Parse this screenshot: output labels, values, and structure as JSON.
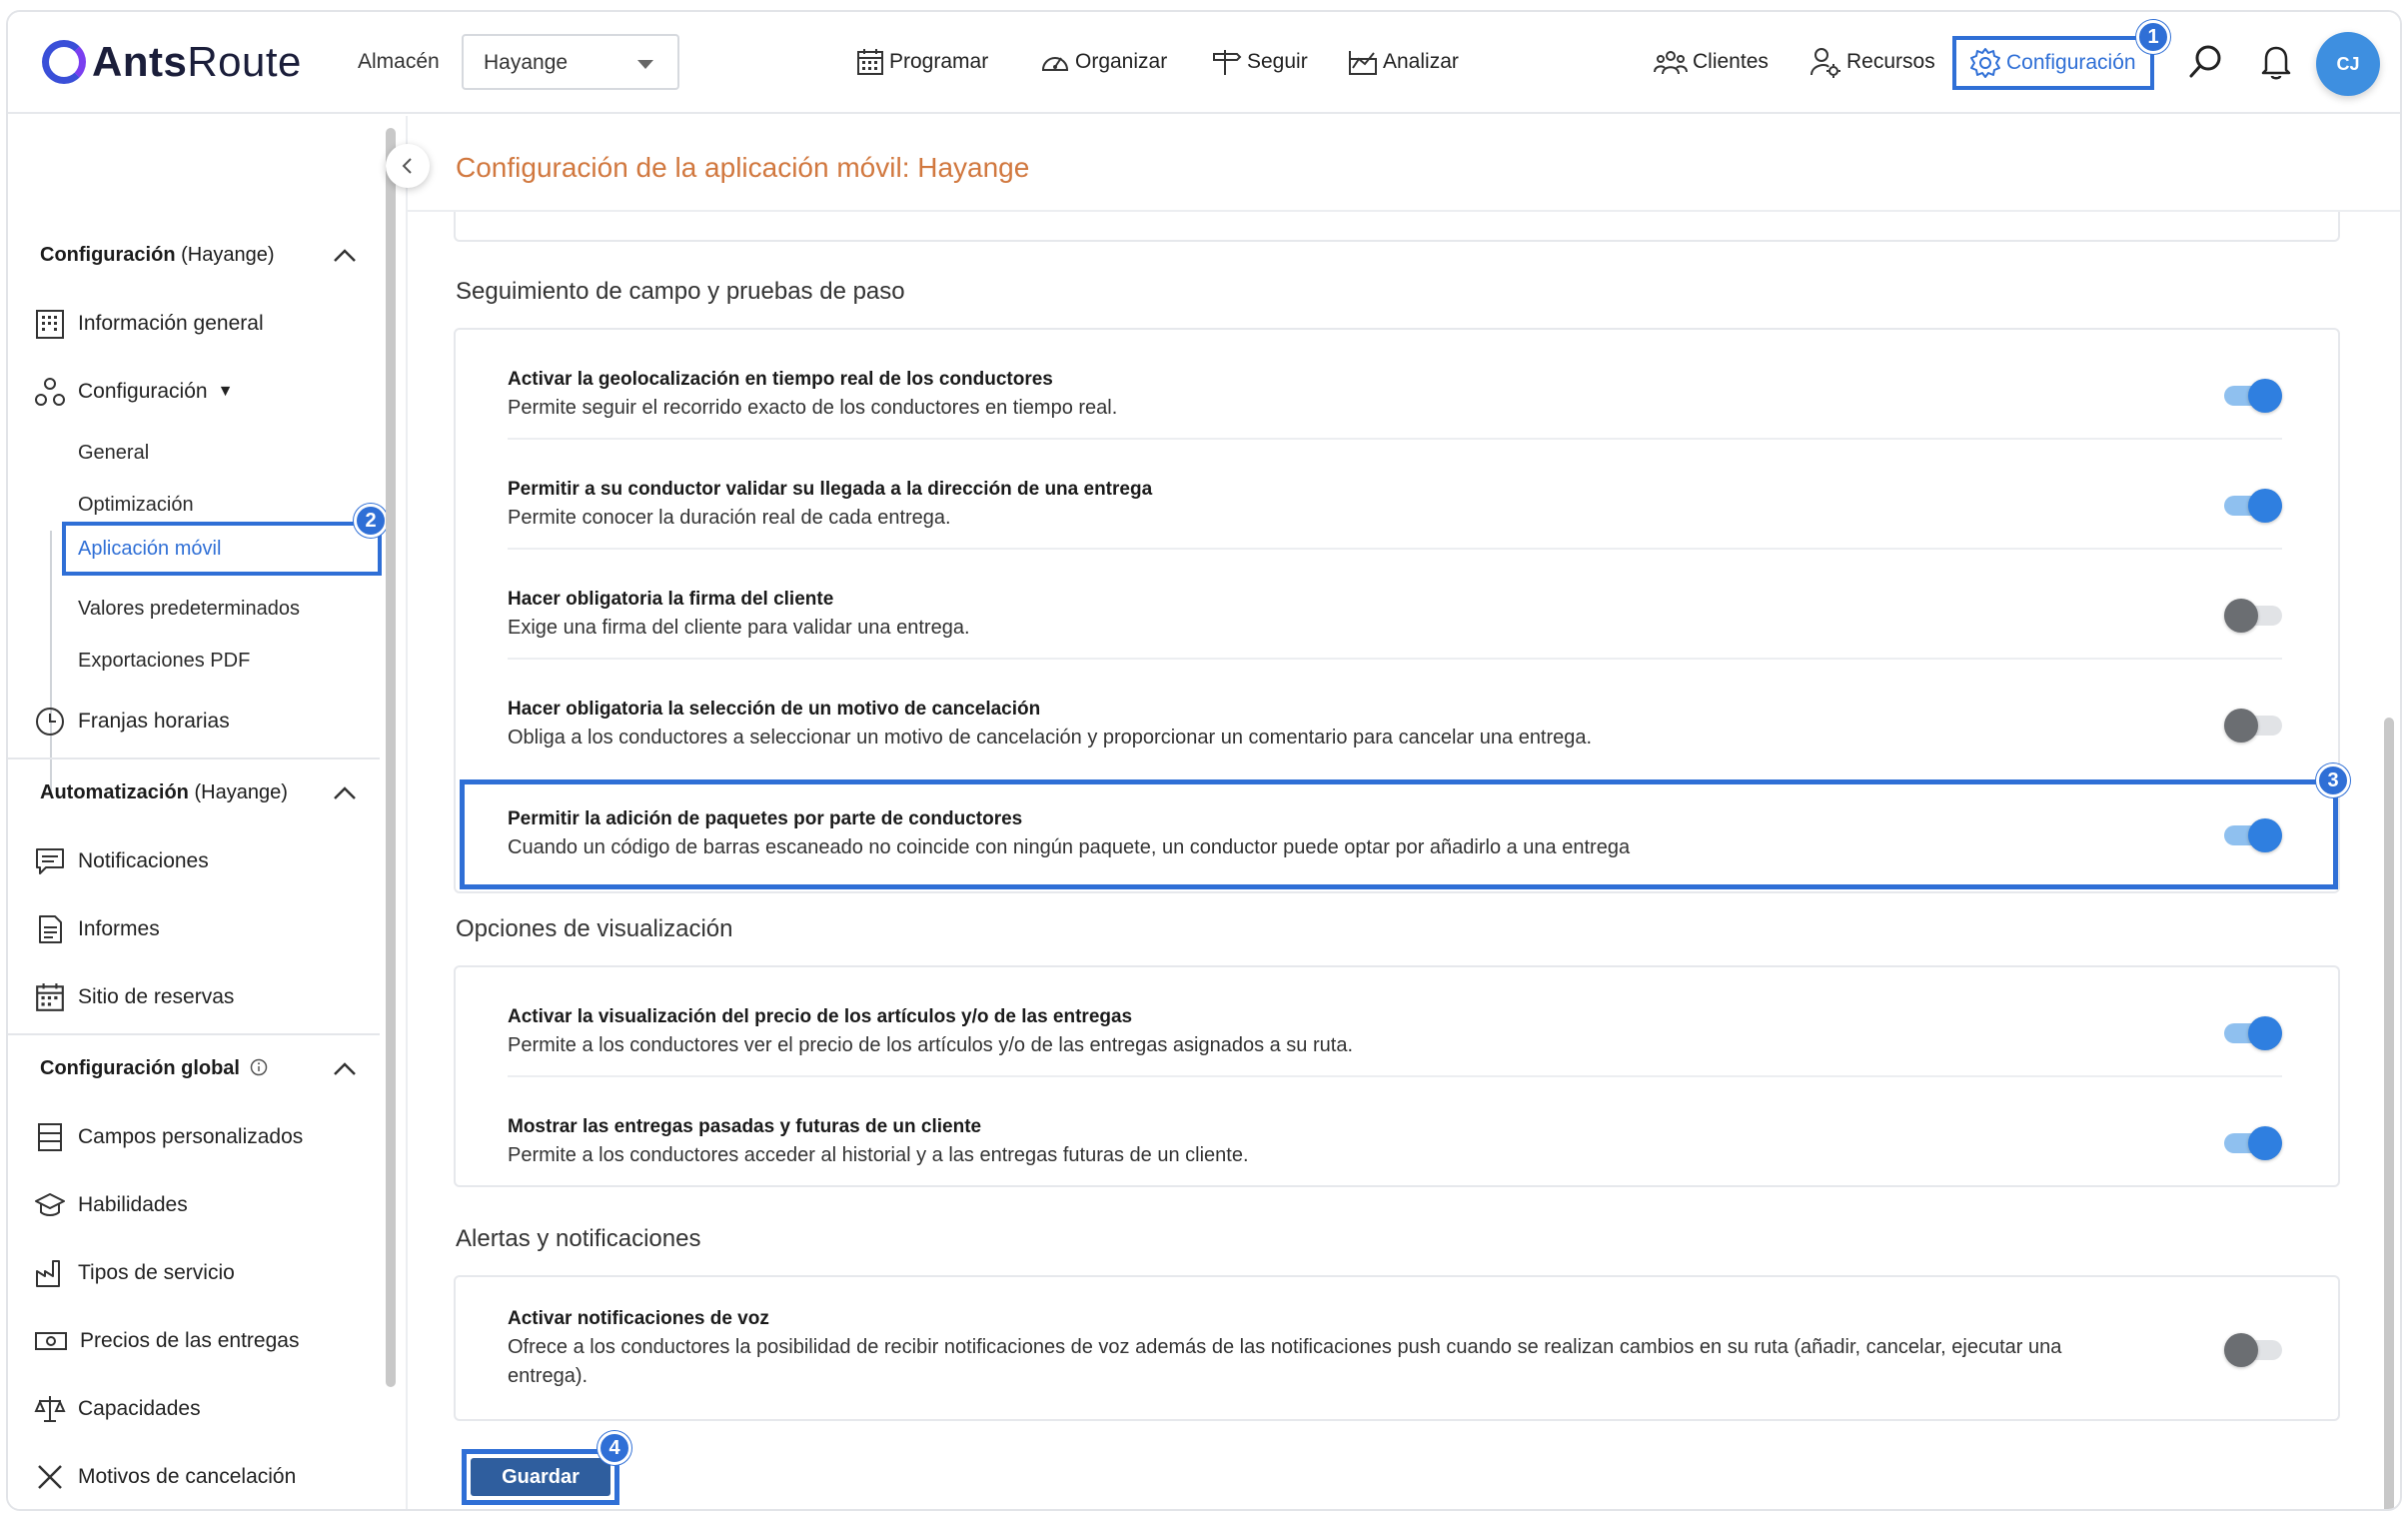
{
  "header": {
    "logo_bold": "Ants",
    "logo_regular": "Route",
    "warehouse_label": "Almacén",
    "warehouse_value": "Hayange",
    "nav": [
      "Programar",
      "Organizar",
      "Seguir",
      "Analizar"
    ],
    "clients": "Clientes",
    "resources": "Recursos",
    "settings": "Configuración",
    "avatar": "CJ"
  },
  "badges": [
    "1",
    "2",
    "3",
    "4"
  ],
  "sidebar": {
    "config_head_bold": "Configuración",
    "config_head_scope": "(Hayange)",
    "general_info": "Información general",
    "config": "Configuración",
    "config_caret": "▼",
    "subitems": [
      "General",
      "Optimización",
      "Aplicación móvil",
      "Valores predeterminados",
      "Exportaciones PDF"
    ],
    "time_windows": "Franjas horarias",
    "auto_head_bold": "Automatización",
    "auto_head_scope": "(Hayange)",
    "notifications": "Notificaciones",
    "reports": "Informes",
    "booking_site": "Sitio de reservas",
    "global_head_bold": "Configuración global",
    "global_items": [
      "Campos personalizados",
      "Habilidades",
      "Tipos de servicio",
      "Precios de las entregas",
      "Capacidades",
      "Motivos de cancelación"
    ]
  },
  "page": {
    "title": "Configuración de la aplicación móvil: Hayange"
  },
  "sections": {
    "tracking": {
      "title": "Seguimiento de campo y pruebas de paso",
      "rows": [
        {
          "title": "Activar la geolocalización en tiempo real de los conductores",
          "desc": "Permite seguir el recorrido exacto de los conductores en tiempo real.",
          "on": true
        },
        {
          "title": "Permitir a su conductor validar su llegada a la dirección de una entrega",
          "desc": "Permite conocer la duración real de cada entrega.",
          "on": true
        },
        {
          "title": "Hacer obligatoria la firma del cliente",
          "desc": "Exige una firma del cliente para validar una entrega.",
          "on": false
        },
        {
          "title": "Hacer obligatoria la selección de un motivo de cancelación",
          "desc": "Obliga a los conductores a seleccionar un motivo de cancelación y proporcionar un comentario para cancelar una entrega.",
          "on": false
        },
        {
          "title": "Permitir la adición de paquetes por parte de conductores",
          "desc": "Cuando un código de barras escaneado no coincide con ningún paquete, un conductor puede optar por añadirlo a una entrega",
          "on": true
        }
      ]
    },
    "display": {
      "title": "Opciones de visualización",
      "rows": [
        {
          "title": "Activar la visualización del precio de los artículos y/o de las entregas",
          "desc": "Permite a los conductores ver el precio de los artículos y/o de las entregas asignados a su ruta.",
          "on": true
        },
        {
          "title": "Mostrar las entregas pasadas y futuras de un cliente",
          "desc": "Permite a los conductores acceder al historial y a las entregas futuras de un cliente.",
          "on": true
        }
      ]
    },
    "alerts": {
      "title": "Alertas y notificaciones",
      "rows": [
        {
          "title": "Activar notificaciones de voz",
          "desc": "Ofrece a los conductores la posibilidad de recibir notificaciones de voz además de las notificaciones push cuando se realizan cambios en su ruta (añadir, cancelar, ejecutar una entrega).",
          "on": false
        }
      ]
    }
  },
  "save_label": "Guardar",
  "colors": {
    "accent": "#2f6fd6",
    "title": "#d1783f",
    "save": "#2f5e9e"
  }
}
